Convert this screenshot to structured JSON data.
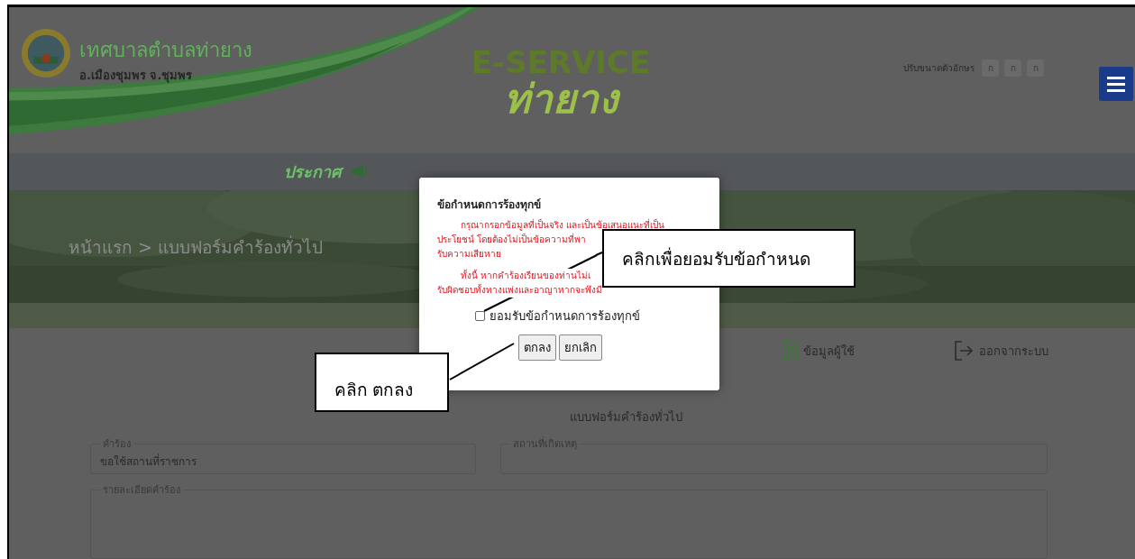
{
  "header": {
    "org_name": "เทศบาลตำบลท่ายาง",
    "org_location": "อ.เมืองชุมพร จ.ชุมพร",
    "service_title": "E-SERVICE",
    "service_subtitle": "ท่ายาง",
    "font_size_label": "ปรับขนาดตัวอักษร",
    "font_size_buttons": [
      "ก",
      "ก",
      "ก"
    ]
  },
  "announcement": {
    "label": "ประกาศ"
  },
  "breadcrumb": "หน้าแรก > แบบฟอร์มคำร้องทั่วไป",
  "user_menu": [
    {
      "label": "ข้อมูลผู้ใช้",
      "kind": "profile"
    },
    {
      "label": "ออกจากระบบ",
      "kind": "logout"
    }
  ],
  "form": {
    "title": "แบบฟอร์มคำร้องทั่วไป",
    "fields": [
      {
        "label": "คำร้อง",
        "value": "ขอใช้สถานที่ราชการ",
        "kind": "input"
      },
      {
        "label": "สถานที่เกิดเหตุ",
        "kind": "input"
      },
      {
        "label": "รายละเอียดคำร้อง",
        "kind": "textarea"
      }
    ]
  },
  "dialog": {
    "title": "ข้อกำหนดการร้องทุกข์",
    "paragraphs": [
      [
        "กรุณากรอกข้อมูลที่เป็นจริง และเป็นข้อเสนอแนะที่เป็น",
        "ประโยชน์ โดยต้องไม่เป็นข้อความที่พา",
        "รับความเสียหาย"
      ],
      [
        "ทั้งนี้ หากคำร้องเรียนของท่านไม่เ",
        "รับผิดชอบทั้งทางแพ่งและอาญาหากจะพึงมี"
      ]
    ],
    "checkbox": {
      "label": "ยอมรับข้อกำหนดการร้องทุกข์",
      "checked": false
    },
    "buttons": [
      "ตกลง",
      "ยกเลิก"
    ]
  },
  "callouts": [
    {
      "text": "คลิกเพื่อยอมรับข้อกำหนด"
    },
    {
      "text": "คลิก ตกลง"
    }
  ]
}
